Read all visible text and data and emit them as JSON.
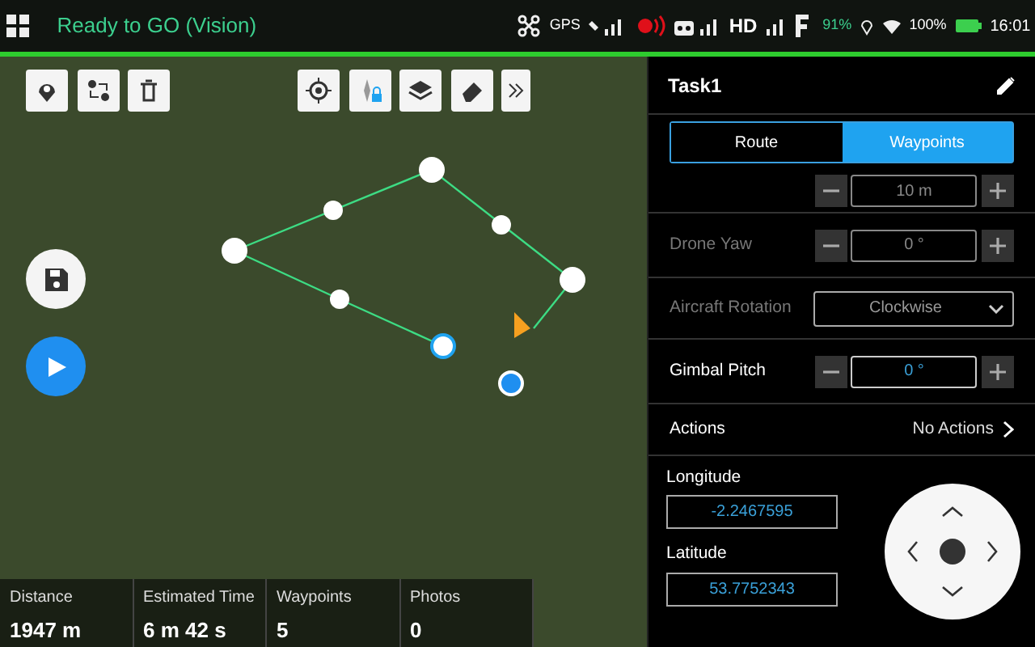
{
  "status_bar": {
    "status": "Ready to GO (Vision)",
    "gps_label": "GPS",
    "hd_label": "HD",
    "aircraft_battery": "91%",
    "phone_battery": "100%",
    "time": "16:01"
  },
  "panel": {
    "title": "Task1",
    "tabs": [
      {
        "label": "Route",
        "selected": false
      },
      {
        "label": "Waypoints",
        "selected": true
      }
    ],
    "settings": [
      {
        "kind": "stepper",
        "value": "10 m",
        "disabled": true
      },
      {
        "kind": "stepper",
        "label": "Drone Yaw",
        "value": "0 °",
        "disabled": true
      },
      {
        "kind": "select",
        "label": "Aircraft Rotation",
        "value": "Clockwise",
        "disabled": true
      },
      {
        "kind": "stepper",
        "label": "Gimbal Pitch",
        "value": "0 °",
        "disabled": false
      },
      {
        "kind": "link",
        "label": "Actions",
        "value": "No Actions",
        "disabled": false
      }
    ],
    "coordinates": [
      {
        "label": "Longitude",
        "value": "-2.2467595"
      },
      {
        "label": "Latitude",
        "value": "53.7752343"
      }
    ]
  },
  "summary": [
    {
      "label": "Distance",
      "value": "1947 m"
    },
    {
      "label": "Estimated Time",
      "value": "6 m 42 s"
    },
    {
      "label": "Waypoints",
      "value": "5"
    },
    {
      "label": "Photos",
      "value": "0"
    }
  ]
}
